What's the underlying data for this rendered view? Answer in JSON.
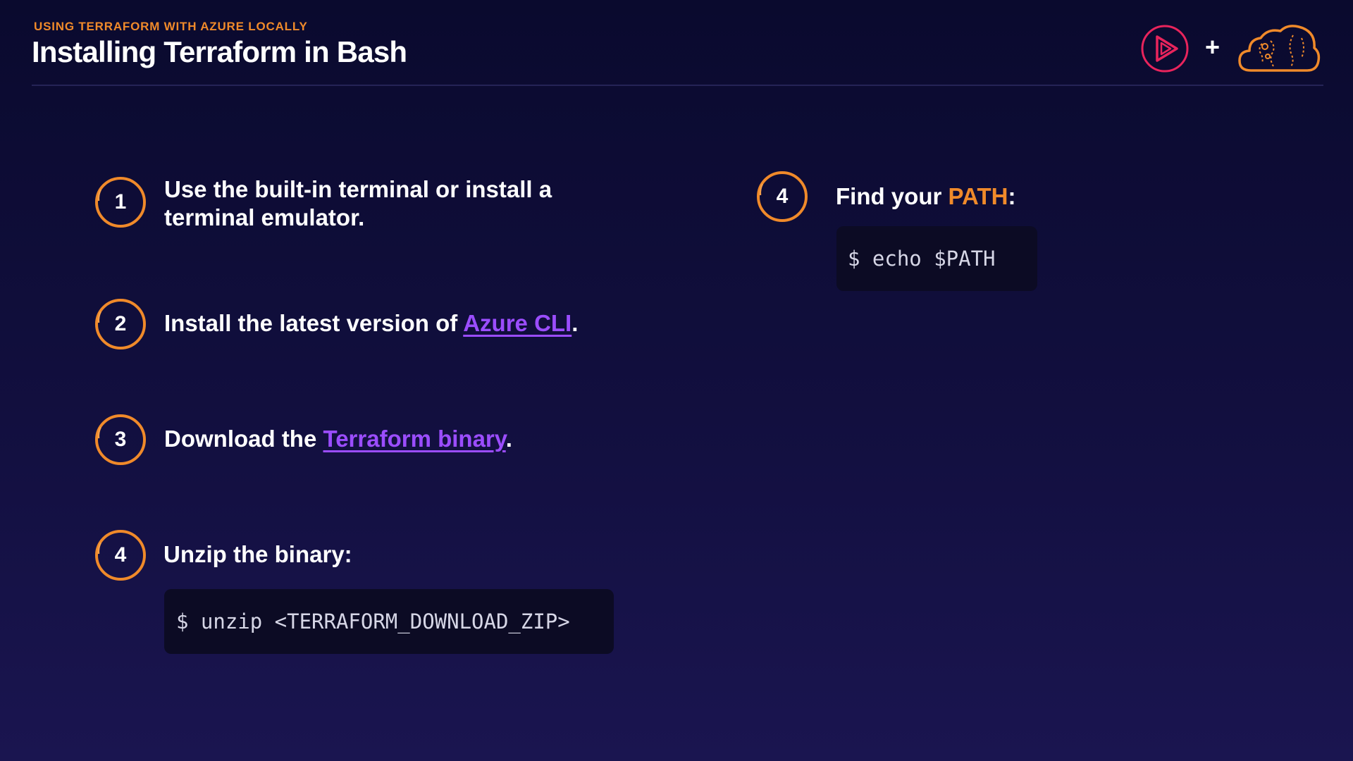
{
  "header": {
    "eyebrow": "USING TERRAFORM WITH AZURE LOCALLY",
    "title": "Installing Terraform in Bash",
    "plus": "+"
  },
  "logos": {
    "left_icon": "play-logo-icon",
    "right_icon": "cloud-logo-icon"
  },
  "steps": [
    {
      "number": "1",
      "line1": "Use the built-in terminal or install a",
      "line2": "terminal emulator."
    },
    {
      "number": "2",
      "text_before": "Install the latest version of ",
      "link": "Azure CLI",
      "text_after": "."
    },
    {
      "number": "3",
      "text_before": "Download the ",
      "link": "Terraform binary",
      "text_after": "."
    },
    {
      "number": "4",
      "text": "Unzip the binary:",
      "code": "$ unzip <TERRAFORM_DOWNLOAD_ZIP>"
    },
    {
      "number": "4",
      "text_before": "Find your ",
      "highlight": "PATH",
      "text_after": ":",
      "code": "$ echo $PATH"
    }
  ],
  "colors": {
    "accent": "#f08a2a",
    "link": "#9b4dff",
    "background": "#120f3f",
    "code_background": "#0c0b24"
  }
}
